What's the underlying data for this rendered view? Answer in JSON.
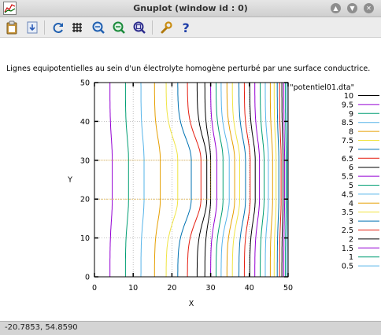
{
  "window": {
    "title": "Gnuplot (window id : 0)",
    "buttons": [
      "up-arrow-icon",
      "down-arrow-icon",
      "close-icon"
    ]
  },
  "toolbar": {
    "items": [
      {
        "name": "copy-to-clipboard-button",
        "icon": "clipboard-icon"
      },
      {
        "name": "print-button",
        "icon": "printer-icon"
      },
      {
        "name": "replot-button",
        "icon": "refresh-icon"
      },
      {
        "name": "toggle-grid-button",
        "icon": "grid-icon"
      },
      {
        "name": "zoom-previous-button",
        "icon": "zoom-back-icon"
      },
      {
        "name": "zoom-next-button",
        "icon": "zoom-forward-icon"
      },
      {
        "name": "autoscale-button",
        "icon": "zoom-fit-icon"
      },
      {
        "name": "options-button",
        "icon": "wrench-icon"
      },
      {
        "name": "help-button",
        "icon": "help-icon"
      }
    ]
  },
  "status": {
    "coords": "-20.7853,  54.8590"
  },
  "chart_data": {
    "type": "line",
    "title": "Lignes equipotentielles au sein d'un électrolyte homogène perturbé par une surface conductrice.",
    "xlabel": "X",
    "ylabel": "Y",
    "xlim": [
      0,
      50
    ],
    "ylim": [
      0,
      50
    ],
    "xticks": [
      0,
      10,
      20,
      30,
      40,
      50
    ],
    "yticks": [
      0,
      10,
      20,
      30,
      40,
      50
    ],
    "grid": true,
    "legend_title": "\"potentiel01.dta\"",
    "legend_position": "right",
    "conductor": {
      "x_end": 30,
      "y_range": [
        20,
        30
      ]
    },
    "series": [
      {
        "name": "10",
        "color": "#000000",
        "x_far": 28.5,
        "x_near": 30.0
      },
      {
        "name": "9.5",
        "color": "#9400d3",
        "x_far": 30.0,
        "x_near": 31.6
      },
      {
        "name": "9",
        "color": "#009e73",
        "x_far": 31.4,
        "x_near": 33.2
      },
      {
        "name": "8.5",
        "color": "#56b4e9",
        "x_far": 32.7,
        "x_near": 34.8
      },
      {
        "name": "8",
        "color": "#e69f00",
        "x_far": 34.2,
        "x_near": 36.2
      },
      {
        "name": "7.5",
        "color": "#f0e442",
        "x_far": 35.6,
        "x_near": 37.5
      },
      {
        "name": "7",
        "color": "#0072b2",
        "x_far": 37.3,
        "x_near": 39.0
      },
      {
        "name": "6.5",
        "color": "#e51e10",
        "x_far": 38.7,
        "x_near": 40.2
      },
      {
        "name": "6",
        "color": "#000000",
        "x_far": 40.1,
        "x_near": 41.5
      },
      {
        "name": "5.5",
        "color": "#9400d3",
        "x_far": 41.4,
        "x_near": 42.6
      },
      {
        "name": "5",
        "color": "#009e73",
        "x_far": 42.8,
        "x_near": 43.8
      },
      {
        "name": "4.5",
        "color": "#56b4e9",
        "x_far": 44.1,
        "x_near": 44.9
      },
      {
        "name": "4",
        "color": "#e69f00",
        "x_far": 45.4,
        "x_near": 46.0
      },
      {
        "name": "3.5",
        "color": "#f0e442",
        "x_far": 46.4,
        "x_near": 46.9
      },
      {
        "name": "3",
        "color": "#0072b2",
        "x_far": 47.2,
        "x_near": 47.6
      },
      {
        "name": "2.5",
        "color": "#e51e10",
        "x_far": 47.8,
        "x_near": 48.2
      },
      {
        "name": "2",
        "color": "#000000",
        "x_far": 48.4,
        "x_near": 48.7
      },
      {
        "name": "1.5",
        "color": "#9400d3",
        "x_far": 48.9,
        "x_near": 49.1
      },
      {
        "name": "1",
        "color": "#009e73",
        "x_far": 49.3,
        "x_near": 49.5
      },
      {
        "name": "0.5",
        "color": "#56b4e9",
        "x_far": 49.7,
        "x_near": 49.8
      }
    ],
    "left_series": [
      {
        "color": "#9400d3",
        "x_far": 4.0,
        "x_near": 4.6
      },
      {
        "color": "#009e73",
        "x_far": 8.0,
        "x_near": 8.8
      },
      {
        "color": "#56b4e9",
        "x_far": 12.0,
        "x_near": 12.8
      },
      {
        "color": "#e69f00",
        "x_far": 15.5,
        "x_near": 17.0
      },
      {
        "color": "#f0e442",
        "x_far": 18.5,
        "x_near": 21.5
      },
      {
        "color": "#0072b2",
        "x_far": 21.5,
        "x_near": 25.0
      },
      {
        "color": "#e51e10",
        "x_far": 24.0,
        "x_near": 27.5
      },
      {
        "color": "#000000",
        "x_far": 26.5,
        "x_near": 29.0
      }
    ]
  }
}
